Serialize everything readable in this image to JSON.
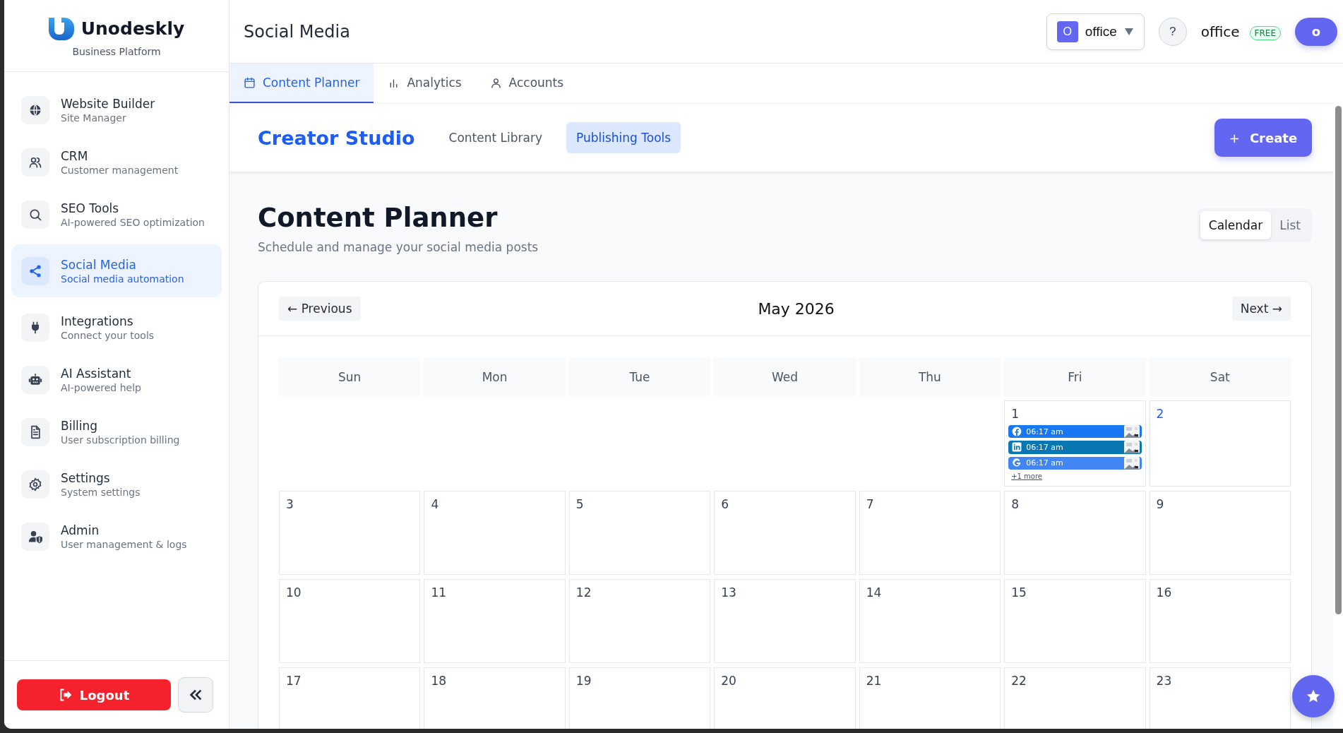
{
  "sidebar": {
    "logo": {
      "name": "Unodeskly",
      "tagline": "Business Platform"
    },
    "items": [
      {
        "title": "Website Builder",
        "subtitle": "Site Manager",
        "selected": false
      },
      {
        "title": "CRM",
        "subtitle": "Customer management",
        "selected": false
      },
      {
        "title": "SEO Tools",
        "subtitle": "AI-powered SEO optimization",
        "selected": false
      },
      {
        "title": "Social Media",
        "subtitle": "Social media automation",
        "selected": true
      },
      {
        "title": "Integrations",
        "subtitle": "Connect your tools",
        "selected": false
      },
      {
        "title": "AI Assistant",
        "subtitle": "AI-powered help",
        "selected": false
      },
      {
        "title": "Billing",
        "subtitle": "User subscription billing",
        "selected": false
      },
      {
        "title": "Settings",
        "subtitle": "System settings",
        "selected": false
      },
      {
        "title": "Admin",
        "subtitle": "User management & logs",
        "selected": false
      }
    ],
    "logout": "Logout"
  },
  "header": {
    "title": "Social Media",
    "workspace": {
      "initial": "O",
      "name": "office"
    },
    "help": "?",
    "user": {
      "name": "office",
      "plan": "FREE",
      "avatar": "o"
    }
  },
  "tabs": [
    {
      "label": "Content Planner",
      "selected": true
    },
    {
      "label": "Analytics",
      "selected": false
    },
    {
      "label": "Accounts",
      "selected": false
    }
  ],
  "studio": {
    "title": "Creator Studio",
    "nav": [
      {
        "label": "Content Library",
        "selected": false
      },
      {
        "label": "Publishing Tools",
        "selected": true
      }
    ],
    "create": {
      "plus": "+",
      "label": "Create"
    }
  },
  "planner": {
    "title": "Content Planner",
    "subtitle": "Schedule and manage your social media posts",
    "views": [
      {
        "label": "Calendar",
        "selected": true
      },
      {
        "label": "List",
        "selected": false
      }
    ]
  },
  "calendar": {
    "previous": "← Previous",
    "month": "May 2026",
    "next": "Next →",
    "weekdays": [
      "Sun",
      "Mon",
      "Tue",
      "Wed",
      "Thu",
      "Fri",
      "Sat"
    ],
    "weeks": [
      [
        {
          "kind": "empty"
        },
        {
          "kind": "empty"
        },
        {
          "kind": "empty"
        },
        {
          "kind": "empty"
        },
        {
          "kind": "empty"
        },
        {
          "kind": "day",
          "day": "1",
          "today": false,
          "events": [
            {
              "kind": "facebook",
              "time": "06:17 am",
              "color": "#1877f2"
            },
            {
              "kind": "linkedin",
              "time": "06:17 am",
              "color": "#0a77b5"
            },
            {
              "kind": "google",
              "time": "06:17 am",
              "color": "#4285f4"
            }
          ],
          "more": "+1 more"
        },
        {
          "kind": "day",
          "day": "2",
          "today": true
        }
      ],
      [
        {
          "day": "3",
          "today": false
        },
        {
          "day": "4",
          "today": false
        },
        {
          "day": "5",
          "today": false
        },
        {
          "day": "6",
          "today": false
        },
        {
          "day": "7",
          "today": false
        },
        {
          "day": "8",
          "today": false
        },
        {
          "day": "9",
          "today": false
        }
      ],
      [
        {
          "day": "10",
          "today": false
        },
        {
          "day": "11",
          "today": false
        },
        {
          "day": "12",
          "today": false
        },
        {
          "day": "13",
          "today": false
        },
        {
          "day": "14",
          "today": false
        },
        {
          "day": "15",
          "today": false
        },
        {
          "day": "16",
          "today": false
        }
      ],
      [
        {
          "day": "17",
          "today": false
        },
        {
          "day": "18",
          "today": false
        },
        {
          "day": "19",
          "today": false
        },
        {
          "day": "20",
          "today": false
        },
        {
          "day": "21",
          "today": false
        },
        {
          "day": "22",
          "today": false
        },
        {
          "day": "23",
          "today": false
        }
      ]
    ]
  }
}
